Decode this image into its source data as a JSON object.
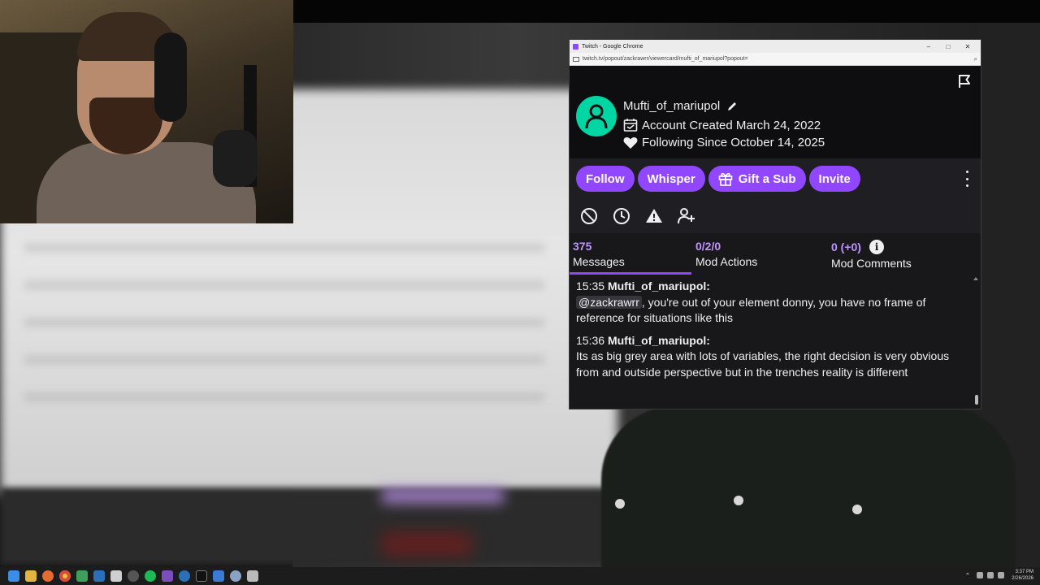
{
  "browser": {
    "window_title": "Twitch - Google Chrome",
    "url": "twitch.tv/popout/zackrawrr/viewercard/mufti_of_mariupol?popout=",
    "controls": {
      "minimize": "–",
      "maximize": "□",
      "close": "✕"
    }
  },
  "viewer_card": {
    "username": "Mufti_of_mariupol",
    "account_created": "Account Created March 24, 2022",
    "following_since": "Following Since October 14, 2025",
    "avatar_color": "#00d6a4",
    "accent_color": "#9147ff"
  },
  "actions": {
    "follow": "Follow",
    "whisper": "Whisper",
    "gift_sub": "Gift a Sub",
    "invite": "Invite"
  },
  "mod_tools": [
    "ban-icon",
    "timeout-icon",
    "warn-icon",
    "add-mod-icon"
  ],
  "tabs": {
    "messages": {
      "count": "375",
      "label": "Messages"
    },
    "mod_actions": {
      "count": "0/2/0",
      "label": "Mod Actions"
    },
    "mod_comments": {
      "count": "0 (+0)",
      "label": "Mod Comments"
    }
  },
  "messages": [
    {
      "time": "15:35",
      "author": "Mufti_of_mariupol",
      "mention": "@zackrawrr",
      "text": ", you're out of your element donny, you have no frame of reference for situations like this"
    },
    {
      "time": "15:36",
      "author": "Mufti_of_mariupol",
      "text": "Its as big grey area with lots of variables, the right decision is very obvious from and outside perspective but in the trenches reality is different"
    }
  ],
  "taskbar": {
    "time": "3:37 PM",
    "date": "2/26/2026"
  }
}
